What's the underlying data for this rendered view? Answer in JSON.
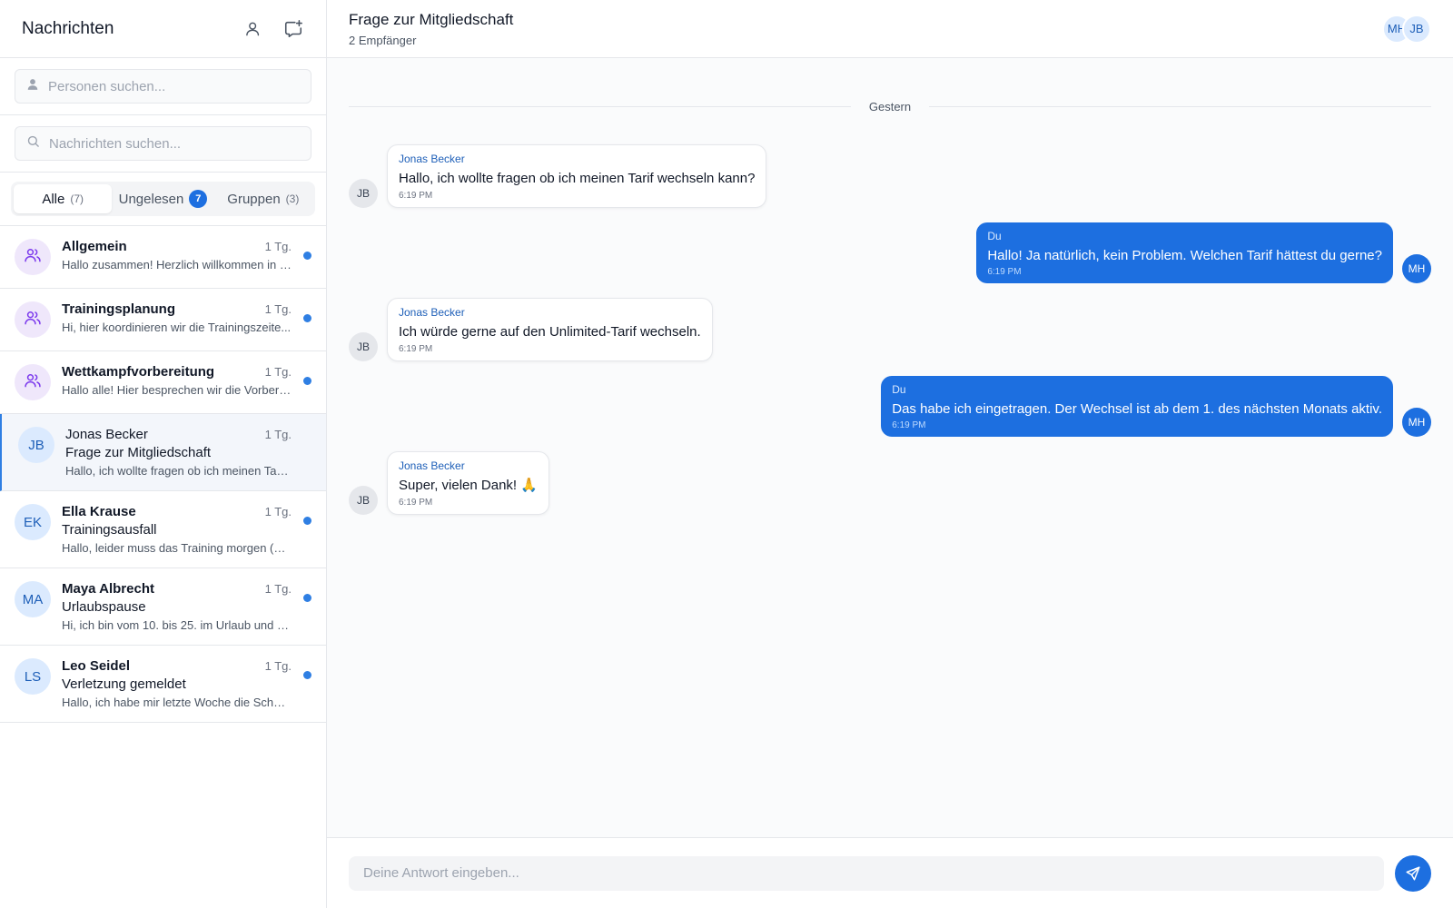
{
  "sidebar": {
    "title": "Nachrichten",
    "icons": [
      "person-icon",
      "new-message-icon"
    ],
    "people_search_placeholder": "Personen suchen...",
    "message_search_placeholder": "Nachrichten suchen...",
    "filters": {
      "all": {
        "label": "Alle",
        "count": "(7)"
      },
      "unread": {
        "label": "Ungelesen",
        "badge": "7"
      },
      "groups": {
        "label": "Gruppen",
        "count": "(3)"
      }
    },
    "conversations": [
      {
        "type": "group",
        "name": "Allgemein",
        "time": "1 Tg.",
        "subject": "",
        "preview": "Hallo zusammen! Herzlich willkommen in d...",
        "unread": true
      },
      {
        "type": "group",
        "name": "Trainingsplanung",
        "time": "1 Tg.",
        "subject": "",
        "preview": "Hi, hier koordinieren wir die Trainingszeite...",
        "unread": true
      },
      {
        "type": "group",
        "name": "Wettkampfvorbereitung",
        "time": "1 Tg.",
        "subject": "",
        "preview": "Hallo alle! Hier besprechen wir die Vorbere...",
        "unread": true
      },
      {
        "type": "person",
        "initials": "JB",
        "name": "Jonas Becker",
        "time": "1 Tg.",
        "subject": "Frage zur Mitgliedschaft",
        "preview": "Hallo, ich wollte fragen ob ich meinen Tarif...",
        "unread": false,
        "active": true
      },
      {
        "type": "person",
        "initials": "EK",
        "name": "Ella Krause",
        "time": "1 Tg.",
        "subject": "Trainingsausfall",
        "preview": "Hallo, leider muss das Training morgen (Di...",
        "unread": true
      },
      {
        "type": "person",
        "initials": "MA",
        "name": "Maya Albrecht",
        "time": "1 Tg.",
        "subject": "Urlaubspause",
        "preview": "Hi, ich bin vom 10. bis 25. im Urlaub und p...",
        "unread": true
      },
      {
        "type": "person",
        "initials": "LS",
        "name": "Leo Seidel",
        "time": "1 Tg.",
        "subject": "Verletzung gemeldet",
        "preview": "Hallo, ich habe mir letzte Woche die Schult...",
        "unread": true
      }
    ]
  },
  "chat": {
    "title": "Frage zur Mitgliedschaft",
    "subtitle": "2 Empfänger",
    "participants": [
      "MH",
      "JB"
    ],
    "date_divider": "Gestern",
    "messages": [
      {
        "direction": "in",
        "initials": "JB",
        "sender": "Jonas Becker",
        "text": "Hallo, ich wollte fragen ob ich meinen Tarif wechseln kann?",
        "time": "6:19 PM"
      },
      {
        "direction": "out",
        "initials": "MH",
        "sender": "Du",
        "text": "Hallo! Ja natürlich, kein Problem. Welchen Tarif hättest du gerne?",
        "time": "6:19 PM"
      },
      {
        "direction": "in",
        "initials": "JB",
        "sender": "Jonas Becker",
        "text": "Ich würde gerne auf den Unlimited-Tarif wechseln.",
        "time": "6:19 PM"
      },
      {
        "direction": "out",
        "initials": "MH",
        "sender": "Du",
        "text": "Das habe ich eingetragen. Der Wechsel ist ab dem 1. des nächsten Monats aktiv.",
        "time": "6:19 PM"
      },
      {
        "direction": "in",
        "initials": "JB",
        "sender": "Jonas Becker",
        "text": "Super, vielen Dank! 🙏",
        "time": "6:19 PM"
      }
    ],
    "composer_placeholder": "Deine Antwort eingeben..."
  },
  "colors": {
    "accent": "#1d6fe0",
    "unread_dot": "#2f7fe3",
    "group_icon": "#7c3aed"
  }
}
